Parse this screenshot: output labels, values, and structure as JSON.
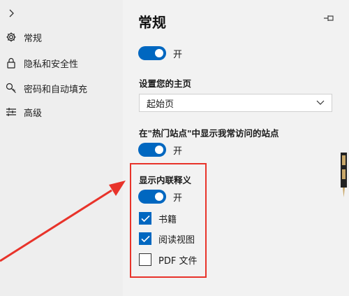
{
  "sidebar": {
    "items": [
      {
        "label": "常规",
        "icon": "gear-icon"
      },
      {
        "label": "隐私和安全性",
        "icon": "lock-icon"
      },
      {
        "label": "密码和自动填充",
        "icon": "key-icon"
      },
      {
        "label": "高级",
        "icon": "sliders-icon"
      }
    ]
  },
  "panel": {
    "title": "常规",
    "toggle_top": {
      "label": "开",
      "on": true
    },
    "homepage": {
      "label": "设置您的主页",
      "selected": "起始页"
    },
    "top_sites": {
      "label": "在\"热门站点\"中显示我常访问的站点",
      "toggle_label": "开",
      "on": true
    },
    "inline_defs": {
      "label": "显示内联释义",
      "toggle_label": "开",
      "on": true,
      "options": [
        {
          "label": "书籍",
          "checked": true
        },
        {
          "label": "阅读视图",
          "checked": true
        },
        {
          "label": "PDF 文件",
          "checked": false
        }
      ]
    }
  },
  "colors": {
    "accent": "#0067c0",
    "highlight": "#e8332a",
    "nav_bg": "#eeeeee",
    "panel_bg": "#f2f2f2"
  }
}
